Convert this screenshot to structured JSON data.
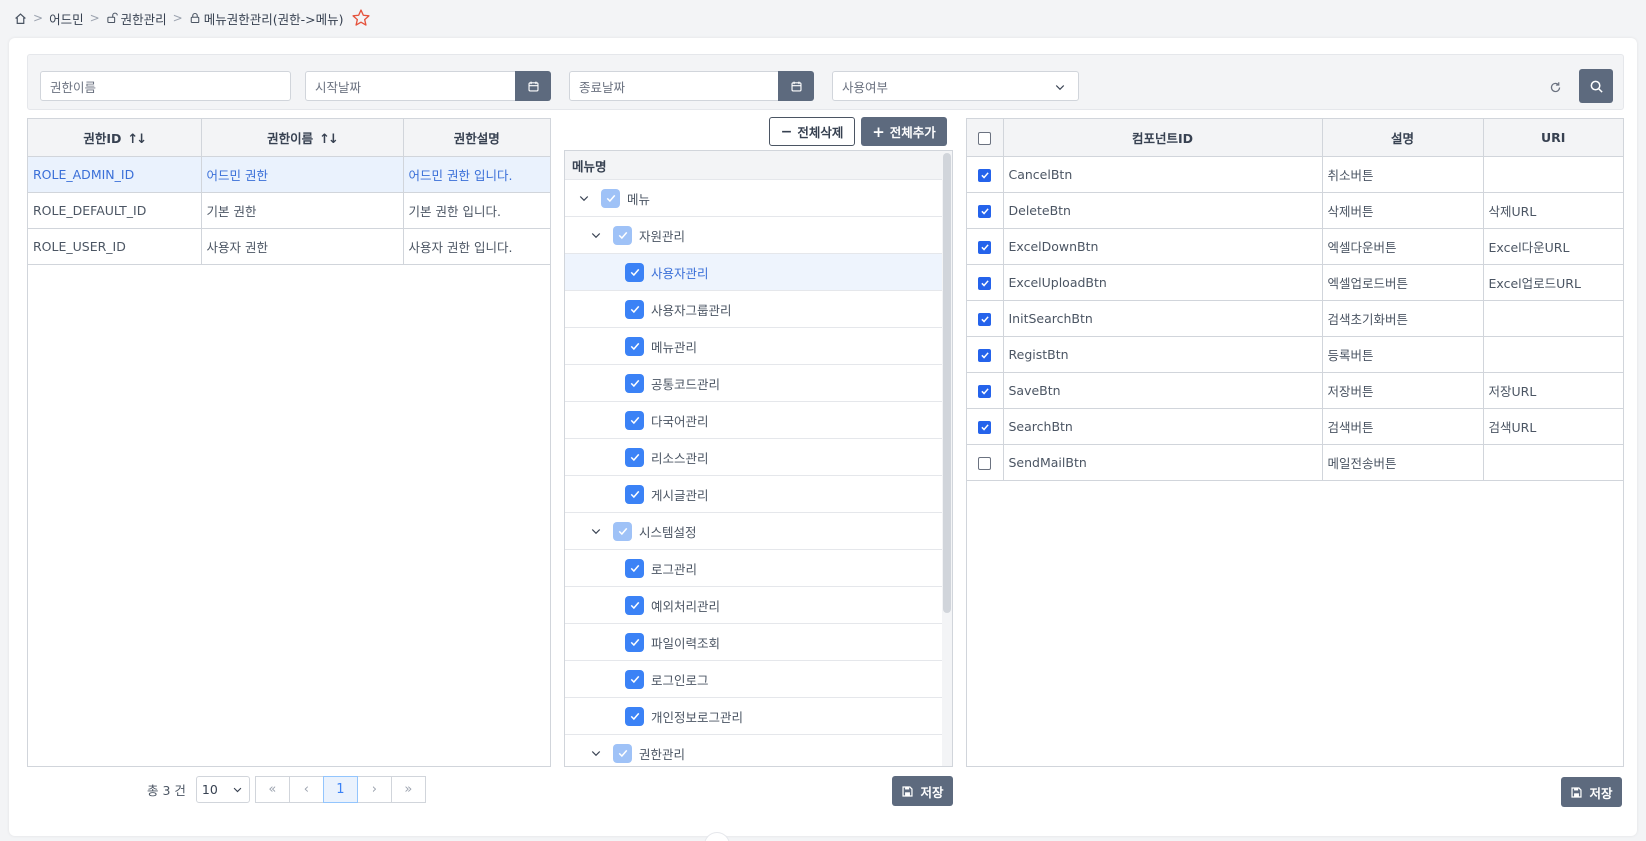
{
  "breadcrumb": {
    "home_icon": "home-icon",
    "items": [
      "어드민",
      "권한관리",
      "메뉴권한관리(권한->메뉴)"
    ],
    "star_color": "#e5533d"
  },
  "search": {
    "role_name_placeholder": "권한이름",
    "start_date_placeholder": "시작날짜",
    "end_date_placeholder": "종료날짜",
    "use_yn_placeholder": "사용여부"
  },
  "role_grid": {
    "headers": [
      "권한ID",
      "권한이름",
      "권한설명"
    ],
    "sort_icon": "↑↓",
    "rows": [
      [
        "ROLE_ADMIN_ID",
        "어드민 권한",
        "어드민 권한 입니다."
      ],
      [
        "ROLE_DEFAULT_ID",
        "기본 권한",
        "기본 권한 입니다."
      ],
      [
        "ROLE_USER_ID",
        "사용자 권한",
        "사용자 권한 입니다."
      ]
    ],
    "selected_index": 0
  },
  "pagination": {
    "total_label": "총 3 건",
    "page_size": "10",
    "first": "«",
    "prev": "‹",
    "current": "1",
    "next": "›",
    "last": "»"
  },
  "tree": {
    "delete_all_label": "전체삭제",
    "add_all_label": "전체추가",
    "header": "메뉴명",
    "nodes": [
      {
        "label": "메뉴",
        "level": 0,
        "expandable": true,
        "state": "partial"
      },
      {
        "label": "자원관리",
        "level": 1,
        "expandable": true,
        "state": "partial"
      },
      {
        "label": "사용자관리",
        "level": 2,
        "expandable": false,
        "state": "checked",
        "selected": true
      },
      {
        "label": "사용자그룹관리",
        "level": 2,
        "expandable": false,
        "state": "checked"
      },
      {
        "label": "메뉴관리",
        "level": 2,
        "expandable": false,
        "state": "checked"
      },
      {
        "label": "공통코드관리",
        "level": 2,
        "expandable": false,
        "state": "checked"
      },
      {
        "label": "다국어관리",
        "level": 2,
        "expandable": false,
        "state": "checked"
      },
      {
        "label": "리소스관리",
        "level": 2,
        "expandable": false,
        "state": "checked"
      },
      {
        "label": "게시글관리",
        "level": 2,
        "expandable": false,
        "state": "checked"
      },
      {
        "label": "시스템설정",
        "level": 1,
        "expandable": true,
        "state": "partial"
      },
      {
        "label": "로그관리",
        "level": 2,
        "expandable": false,
        "state": "checked"
      },
      {
        "label": "예외처리관리",
        "level": 2,
        "expandable": false,
        "state": "checked"
      },
      {
        "label": "파일이력조회",
        "level": 2,
        "expandable": false,
        "state": "checked"
      },
      {
        "label": "로그인로그",
        "level": 2,
        "expandable": false,
        "state": "checked"
      },
      {
        "label": "개인정보로그관리",
        "level": 2,
        "expandable": false,
        "state": "checked"
      },
      {
        "label": "권한관리",
        "level": 1,
        "expandable": true,
        "state": "partial"
      }
    ],
    "save_label": "저장"
  },
  "component_grid": {
    "headers": [
      "컴포넌트ID",
      "설명",
      "URI"
    ],
    "rows": [
      {
        "checked": true,
        "id": "CancelBtn",
        "desc": "취소버튼",
        "uri": ""
      },
      {
        "checked": true,
        "id": "DeleteBtn",
        "desc": "삭제버튼",
        "uri": "삭제URL"
      },
      {
        "checked": true,
        "id": "ExcelDownBtn",
        "desc": "엑셀다운버튼",
        "uri": "Excel다운URL"
      },
      {
        "checked": true,
        "id": "ExcelUploadBtn",
        "desc": "엑셀업로드버튼",
        "uri": "Excel업로드URL"
      },
      {
        "checked": true,
        "id": "InitSearchBtn",
        "desc": "검색초기화버튼",
        "uri": ""
      },
      {
        "checked": true,
        "id": "RegistBtn",
        "desc": "등록버튼",
        "uri": ""
      },
      {
        "checked": true,
        "id": "SaveBtn",
        "desc": "저장버튼",
        "uri": "저장URL"
      },
      {
        "checked": true,
        "id": "SearchBtn",
        "desc": "검색버튼",
        "uri": "검색URL"
      },
      {
        "checked": false,
        "id": "SendMailBtn",
        "desc": "메일전송버튼",
        "uri": ""
      }
    ],
    "save_label": "저장"
  },
  "colors": {
    "accent": "#3b82f6",
    "button_dark": "#5d6a7e",
    "selected_row": "#eaf2fd"
  }
}
